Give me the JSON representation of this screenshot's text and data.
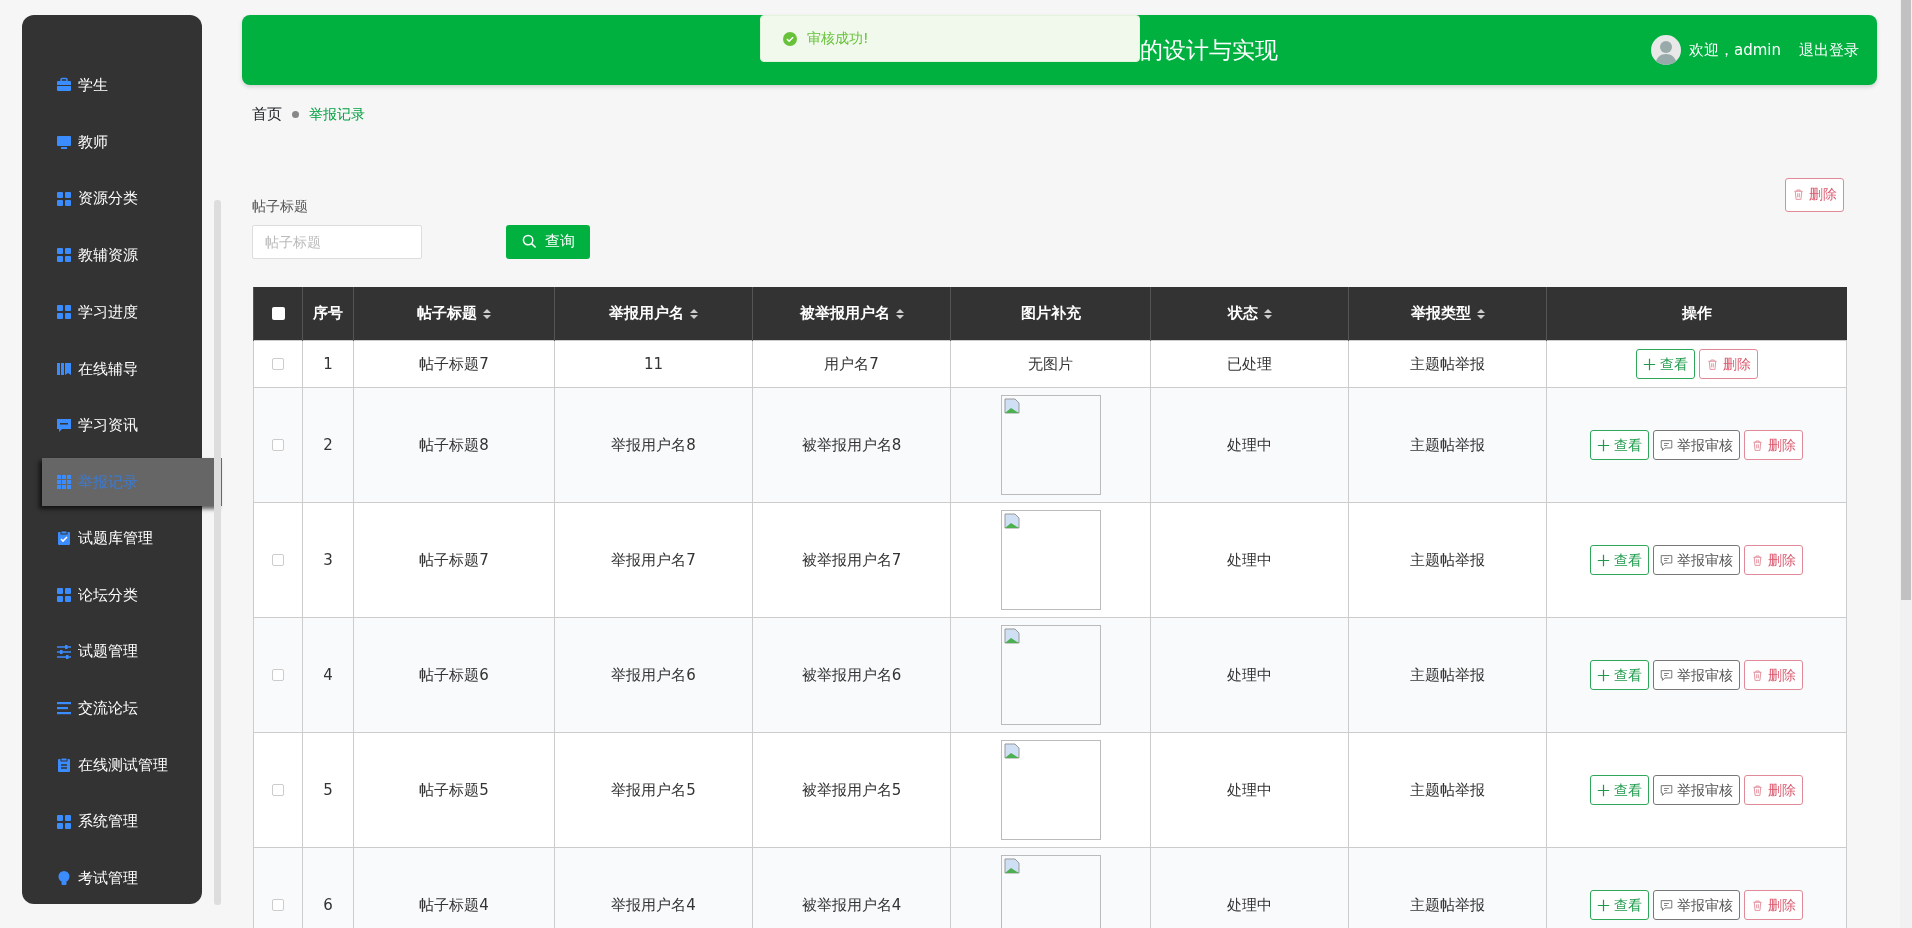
{
  "sidebar": {
    "items": [
      {
        "label": "学生",
        "selected": false
      },
      {
        "label": "教师",
        "selected": false
      },
      {
        "label": "资源分类",
        "selected": false
      },
      {
        "label": "教辅资源",
        "selected": false
      },
      {
        "label": "学习进度",
        "selected": false
      },
      {
        "label": "在线辅导",
        "selected": false
      },
      {
        "label": "学习资讯",
        "selected": false
      },
      {
        "label": "举报记录",
        "selected": true
      },
      {
        "label": "试题库管理",
        "selected": false
      },
      {
        "label": "论坛分类",
        "selected": false
      },
      {
        "label": "试题管理",
        "selected": false
      },
      {
        "label": "交流论坛",
        "selected": false
      },
      {
        "label": "在线测试管理",
        "selected": false
      },
      {
        "label": "系统管理",
        "selected": false
      },
      {
        "label": "考试管理",
        "selected": false
      }
    ]
  },
  "header": {
    "title": "的设计与实现",
    "welcome": "欢迎，admin",
    "logout": "退出登录"
  },
  "toast": {
    "message": "审核成功!"
  },
  "breadcrumb": [
    {
      "label": "首页",
      "selected": false
    },
    {
      "label": "举报记录",
      "selected": true
    }
  ],
  "filter": {
    "label": "帖子标题",
    "placeholder": "帖子标题",
    "search_button": "查询",
    "delete_button": "删除"
  },
  "table": {
    "select_all": {
      "checked": false
    },
    "columns": [
      {
        "label": "序号",
        "sortable": false
      },
      {
        "label": "帖子标题",
        "sortable": true
      },
      {
        "label": "举报用户名",
        "sortable": true
      },
      {
        "label": "被举报用户名",
        "sortable": true
      },
      {
        "label": "图片补充",
        "sortable": false
      },
      {
        "label": "状态",
        "sortable": true
      },
      {
        "label": "举报类型",
        "sortable": true
      },
      {
        "label": "操作",
        "sortable": false
      }
    ],
    "rows": [
      {
        "checked": false,
        "index": "1",
        "title": "帖子标题7",
        "reporter": "11",
        "reported": "用户名7",
        "image": {
          "kind": "text",
          "text": "无图片"
        },
        "status": "已处理",
        "type": "主题帖举报",
        "actions": [
          {
            "kind": "view",
            "label": "查看"
          },
          {
            "kind": "delete",
            "label": "删除"
          }
        ]
      },
      {
        "checked": false,
        "index": "2",
        "title": "帖子标题8",
        "reporter": "举报用户名8",
        "reported": "被举报用户名8",
        "image": {
          "kind": "broken"
        },
        "status": "处理中",
        "type": "主题帖举报",
        "actions": [
          {
            "kind": "view",
            "label": "查看"
          },
          {
            "kind": "review",
            "label": "举报审核"
          },
          {
            "kind": "delete",
            "label": "删除"
          }
        ]
      },
      {
        "checked": false,
        "index": "3",
        "title": "帖子标题7",
        "reporter": "举报用户名7",
        "reported": "被举报用户名7",
        "image": {
          "kind": "broken"
        },
        "status": "处理中",
        "type": "主题帖举报",
        "actions": [
          {
            "kind": "view",
            "label": "查看"
          },
          {
            "kind": "review",
            "label": "举报审核"
          },
          {
            "kind": "delete",
            "label": "删除"
          }
        ]
      },
      {
        "checked": false,
        "index": "4",
        "title": "帖子标题6",
        "reporter": "举报用户名6",
        "reported": "被举报用户名6",
        "image": {
          "kind": "broken"
        },
        "status": "处理中",
        "type": "主题帖举报",
        "actions": [
          {
            "kind": "view",
            "label": "查看"
          },
          {
            "kind": "review",
            "label": "举报审核"
          },
          {
            "kind": "delete",
            "label": "删除"
          }
        ]
      },
      {
        "checked": false,
        "index": "5",
        "title": "帖子标题5",
        "reporter": "举报用户名5",
        "reported": "被举报用户名5",
        "image": {
          "kind": "broken"
        },
        "status": "处理中",
        "type": "主题帖举报",
        "actions": [
          {
            "kind": "view",
            "label": "查看"
          },
          {
            "kind": "review",
            "label": "举报审核"
          },
          {
            "kind": "delete",
            "label": "删除"
          }
        ]
      },
      {
        "checked": false,
        "index": "6",
        "title": "帖子标题4",
        "reporter": "举报用户名4",
        "reported": "被举报用户名4",
        "image": {
          "kind": "broken"
        },
        "status": "处理中",
        "type": "主题帖举报",
        "actions": [
          {
            "kind": "view",
            "label": "查看"
          },
          {
            "kind": "review",
            "label": "举报审核"
          },
          {
            "kind": "delete",
            "label": "删除"
          }
        ]
      }
    ]
  }
}
